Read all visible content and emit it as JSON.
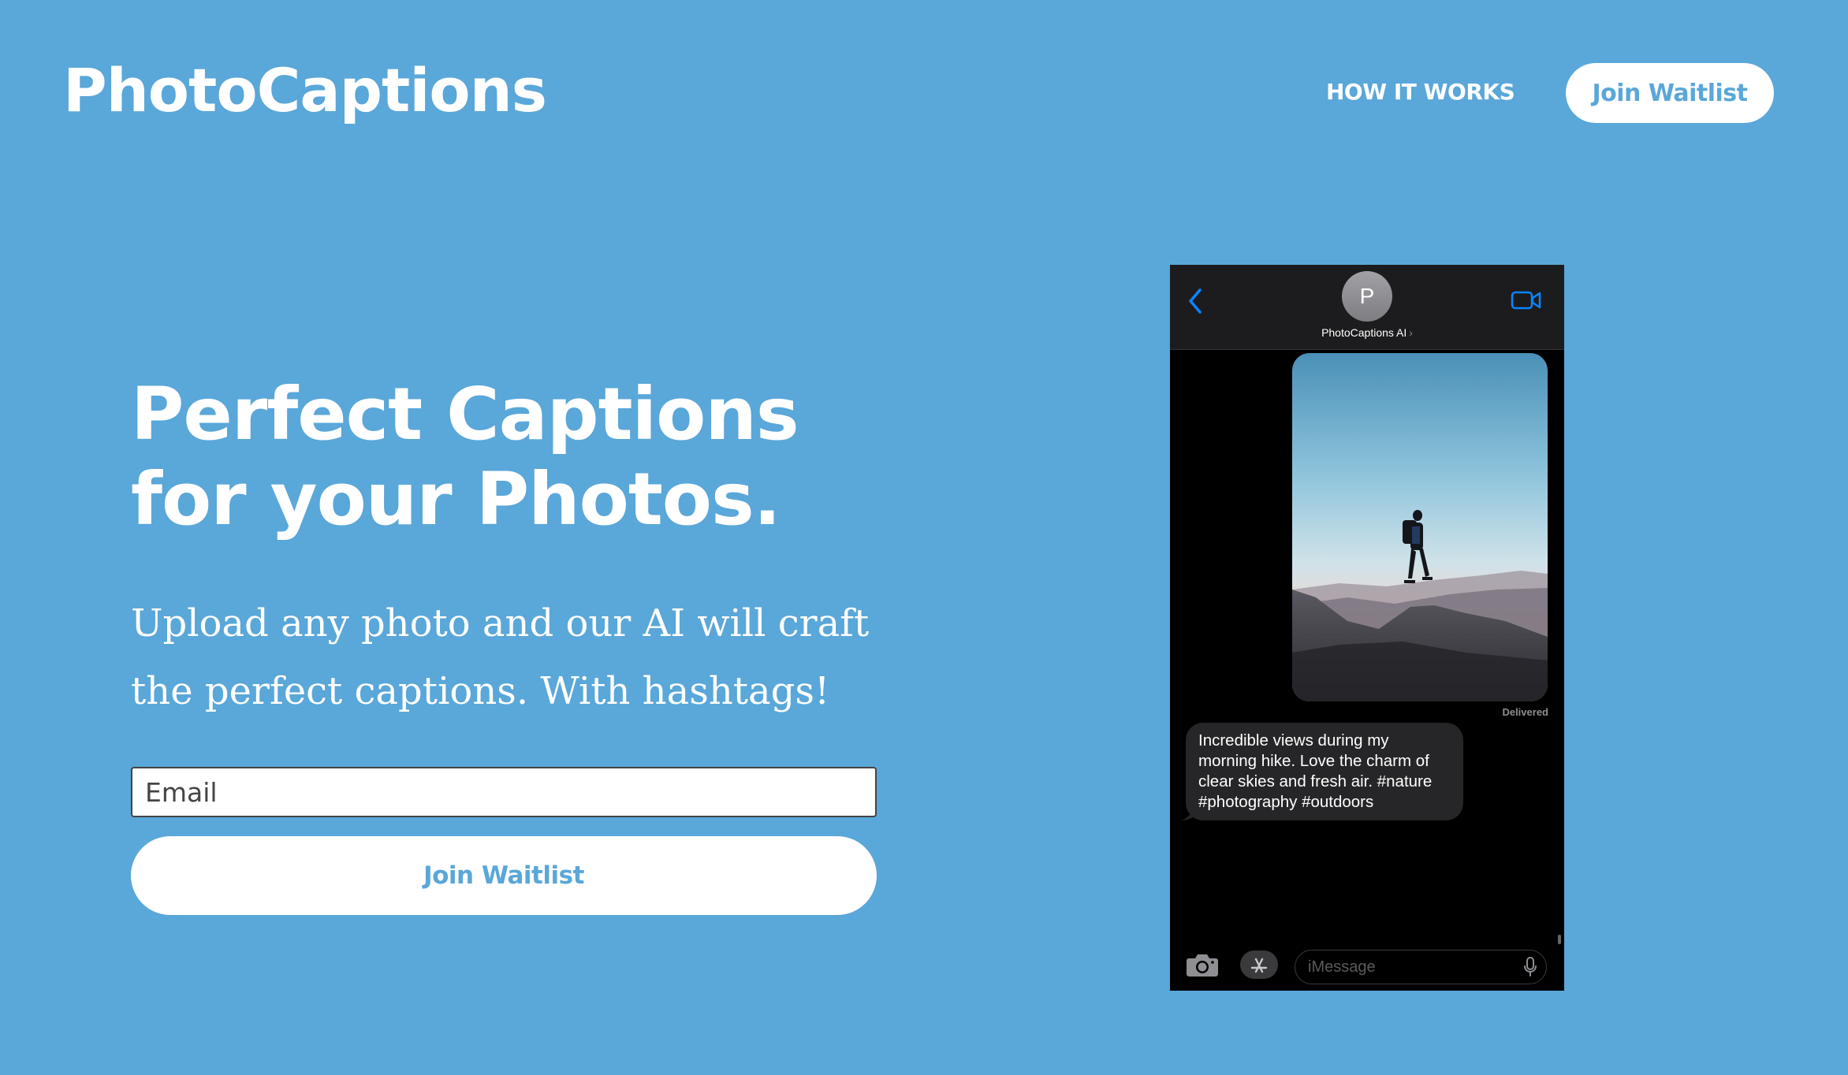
{
  "brand": {
    "name": "PhotoCaptions"
  },
  "nav": {
    "how_it_works": "HOW IT WORKS",
    "cta_label": "Join Waitlist"
  },
  "hero": {
    "headline_line1": "Perfect Captions",
    "headline_line2": "for your Photos.",
    "subtext_line1": "Upload any photo and our AI will craft",
    "subtext_line2": "the perfect captions. With hashtags!",
    "email_placeholder": "Email",
    "cta_label": "Join Waitlist"
  },
  "phone": {
    "avatar_initial": "P",
    "contact_name": "PhotoCaptions AI",
    "delivered": "Delivered",
    "reply": "Incredible views during my morning hike. Love the charm of clear skies and fresh air. #nature #photography #outdoors",
    "input_placeholder": "iMessage",
    "icons": [
      "back-chevron-icon",
      "video-camera-icon",
      "camera-icon",
      "app-store-icon",
      "microphone-icon"
    ]
  },
  "colors": {
    "background": "#5aa7d9",
    "accent": "#5aa7d9",
    "imessage_blue": "#0a84ff"
  }
}
